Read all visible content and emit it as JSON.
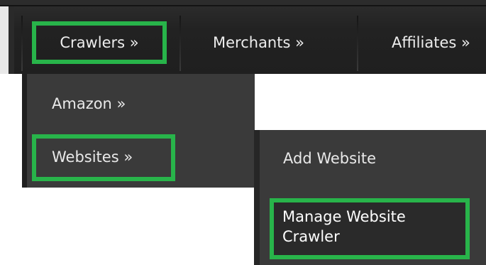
{
  "topnav": {
    "items": [
      {
        "label": "Crawlers »"
      },
      {
        "label": "Merchants »"
      },
      {
        "label": "Affiliates »"
      }
    ]
  },
  "crawlers_menu": {
    "items": [
      {
        "label": "Amazon »"
      },
      {
        "label": "Websites »"
      }
    ]
  },
  "websites_menu": {
    "items": [
      {
        "label": "Add Website"
      },
      {
        "label": "Manage Website Crawler"
      }
    ]
  },
  "colors": {
    "highlight": "#28b44a",
    "bar": "#222222",
    "menu": "#3a3a3a",
    "text": "#ededed"
  }
}
